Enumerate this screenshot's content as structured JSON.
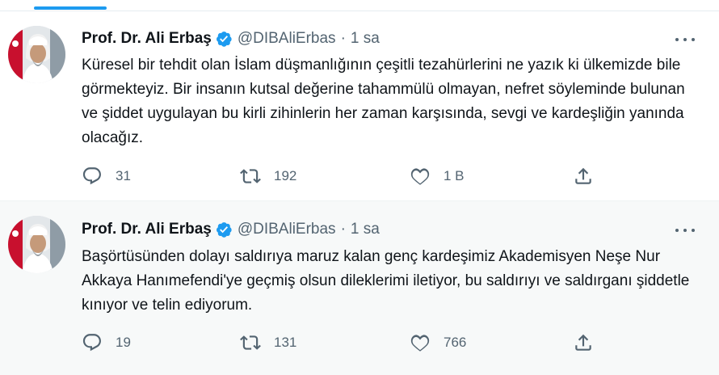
{
  "tweets": [
    {
      "author_name": "Prof. Dr. Ali Erbaş",
      "handle": "@DIBAliErbas",
      "separator": "·",
      "time": "1 sa",
      "text": "Küresel bir tehdit olan İslam düşmanlığının çeşitli tezahürlerini ne yazık ki ülkemizde bile görmekteyiz. Bir insanın kutsal değerine tahammülü olmayan, nefret söyleminde bulunan ve şiddet uygulayan bu kirli zihinlerin her zaman karşısında, sevgi ve kardeşliğin yanında olacağız.",
      "replies": "31",
      "retweets": "192",
      "likes": "1 B",
      "share": ""
    },
    {
      "author_name": "Prof. Dr. Ali Erbaş",
      "handle": "@DIBAliErbas",
      "separator": "·",
      "time": "1 sa",
      "text": "Başörtüsünden dolayı saldırıya maruz kalan genç kardeşimiz Akademisyen Neşe Nur Akkaya Hanımefendi'ye geçmiş olsun dileklerimi iletiyor, bu saldırıyı ve saldırganı şiddetle kınıyor ve telin ediyorum.",
      "replies": "19",
      "retweets": "131",
      "likes": "766",
      "share": ""
    }
  ],
  "icons": {
    "verified": "verified-badge-icon",
    "more": "more-icon",
    "reply": "reply-icon",
    "retweet": "retweet-icon",
    "like": "like-icon",
    "share": "share-icon"
  },
  "colors": {
    "accent": "#1d9bf0",
    "muted": "#536471",
    "text": "#0f1419",
    "thread_line": "#c4cfd6",
    "alt_background": "#f7f9f9"
  }
}
